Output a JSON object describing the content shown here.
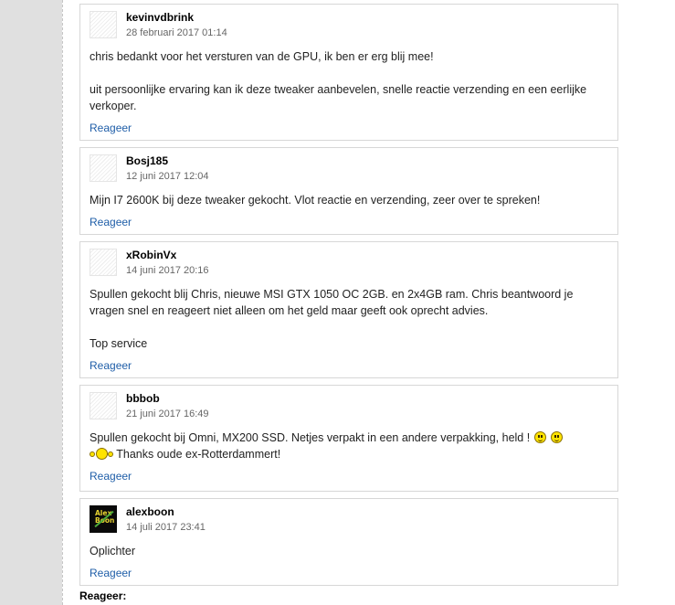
{
  "reactions": [
    {
      "username": "kevinvdbrink",
      "date": "28 februari 2017 01:14",
      "paragraphs": [
        "chris bedankt voor het versturen van de GPU, ik ben er erg blij mee!",
        "uit persoonlijke ervaring kan ik deze tweaker aanbevelen, snelle reactie verzending en een eerlijke verkoper."
      ],
      "reply_label": "Reageer"
    },
    {
      "username": "Bosj185",
      "date": "12 juni 2017 12:04",
      "paragraphs": [
        "Mijn I7 2600K bij deze tweaker gekocht. Vlot reactie en verzending, zeer over te spreken!"
      ],
      "reply_label": "Reageer"
    },
    {
      "username": "xRobinVx",
      "date": "14 juni 2017 20:16",
      "paragraphs": [
        "Spullen gekocht blij Chris, nieuwe MSI GTX 1050 OC 2GB. en 2x4GB ram. Chris beantwoord je vragen snel en reageert niet alleen om het geld maar geeft ook oprecht advies.",
        "Top service"
      ],
      "reply_label": "Reageer"
    },
    {
      "username": "bbbob",
      "date": "21 juni 2017 16:49",
      "text_before": "Spullen gekocht bij Omni, MX200 SSD. Netjes verpakt in een andere verpakking, held !",
      "text_after": " Thanks oude ex-Rotterdammert!",
      "icons": [
        "smiley-icon",
        "smiley-icon",
        "applause-smiley-icon"
      ],
      "reply_label": "Reageer"
    },
    {
      "username": "alexboon",
      "date": "14 juli 2017 23:41",
      "avatar_text": "Alex Boon",
      "paragraphs": [
        "Oplichter"
      ],
      "reply_label": "Reageer"
    }
  ],
  "reply_form": {
    "heading": "Reageer:"
  }
}
